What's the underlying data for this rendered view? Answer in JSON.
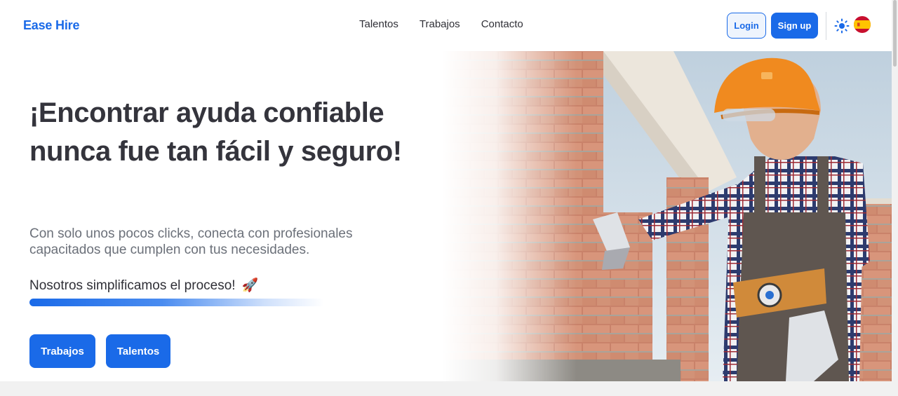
{
  "brand": {
    "name": "Ease Hire",
    "color": "#1a6ae8"
  },
  "nav": {
    "items": [
      {
        "label": "Talentos"
      },
      {
        "label": "Trabajos"
      },
      {
        "label": "Contacto"
      }
    ]
  },
  "auth": {
    "login_label": "Login",
    "signup_label": "Sign up"
  },
  "toolbar": {
    "theme_icon": "sun-icon",
    "language_icon": "spain-flag-icon"
  },
  "hero": {
    "title": "¡Encontrar ayuda confiable nunca fue tan fácil y seguro!",
    "subtitle": "Con solo unos pocos clicks, conecta con profesionales capacitados que cumplen con tus necesidades.",
    "tagline": "Nosotros simplificamos el proceso!",
    "tagline_emoji": "🚀",
    "buttons": {
      "jobs_label": "Trabajos",
      "talents_label": "Talentos"
    },
    "image_alt": "construction-worker-laying-bricks"
  },
  "colors": {
    "accent": "#1a6ae8",
    "title_text": "#34343c",
    "subtitle_text": "#6b7079"
  }
}
